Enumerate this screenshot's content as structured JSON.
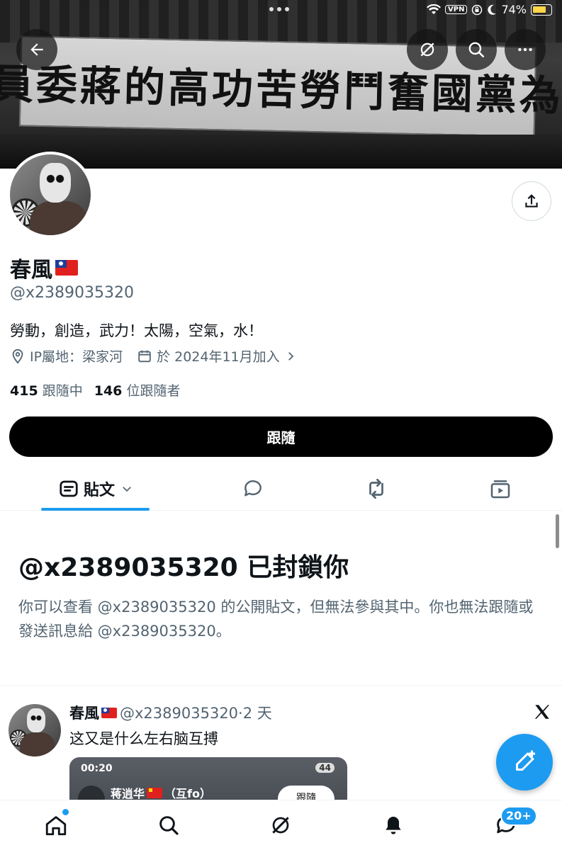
{
  "status_bar": {
    "vpn": "VPN",
    "battery": "74%"
  },
  "banner": {
    "sign_text": "長員委蔣的高功苦勞鬥奮國黨為擁"
  },
  "profile": {
    "name": "春風",
    "handle": "@x2389035320",
    "bio": "勞動，創造，武力！太陽，空氣，水！",
    "location": "IP屬地：梁家河",
    "joined": "於 2024年11月加入",
    "following_count": "415",
    "following_label": "跟隨中",
    "followers_count": "146",
    "followers_label": "位跟隨者",
    "follow_button": "跟隨"
  },
  "tabs": {
    "posts_label": "貼文"
  },
  "blocked": {
    "title": "@x2389035320 已封鎖你",
    "description": "你可以查看 @x2389035320 的公開貼文，但無法參與其中。你也無法跟隨或發送訊息給 @x2389035320。"
  },
  "post": {
    "name": "春風",
    "handle_time": "@x2389035320·2 天",
    "text": "这又是什么左右脑互搏",
    "media": {
      "time": "00:20",
      "badge": "44",
      "name": "蒋逍华",
      "name_suffix": "（互fo）",
      "follow": "跟隨"
    }
  },
  "bottom_nav": {
    "badge": "20+"
  },
  "icons": [
    "back-arrow-icon",
    "grok-icon",
    "search-icon",
    "more-icon",
    "share-icon",
    "location-icon",
    "calendar-icon",
    "chevron-right-icon",
    "posts-icon",
    "chevron-down-icon",
    "reply-icon",
    "repost-icon",
    "media-icon",
    "x-logo-icon",
    "compose-icon",
    "home-icon",
    "bell-icon",
    "messages-icon"
  ]
}
